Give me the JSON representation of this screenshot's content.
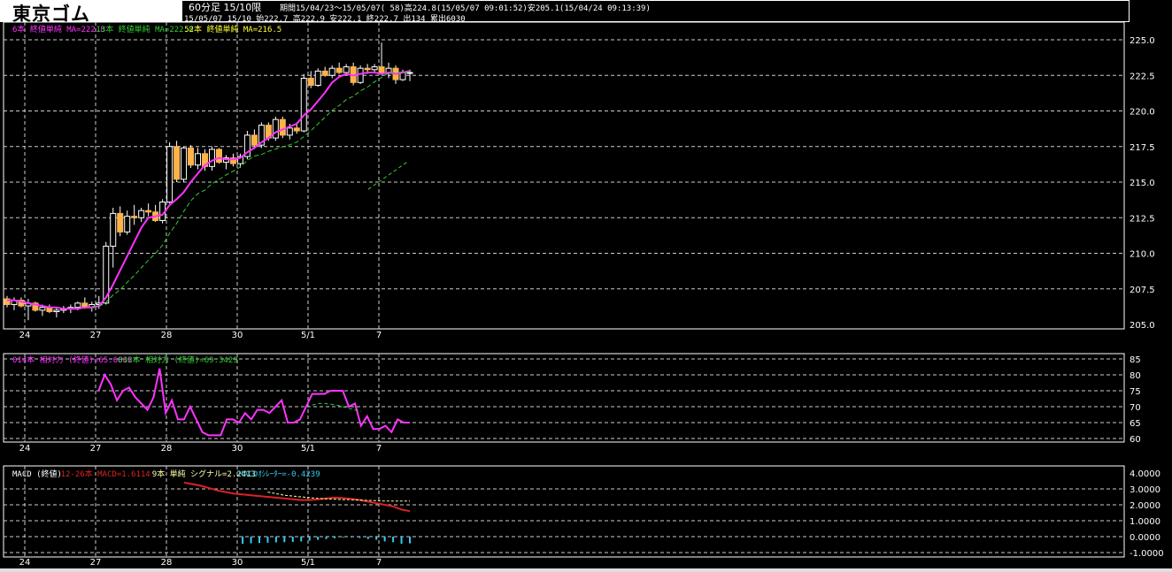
{
  "header": {
    "title": "東京ゴム",
    "timeframe": "60分足 15/10限",
    "period": "期間15/04/23〜15/05/07( 58)高224.8(15/05/07 09:01:52)安205.1(15/04/24 09:13:39)",
    "ohlc": "15/05/07 15/10 始222.7 高222.9 安222.1 終222.7 出134 累出6030"
  },
  "colors": {
    "ma6": "#ff33ff",
    "ma13": "#33cc33",
    "ma52": "#ffff33",
    "candle_up": "#ffb347",
    "macd": "#dd2222",
    "signal": "#ffffaa",
    "hist": "#33ccee"
  },
  "chart_data": [
    {
      "type": "candlestick",
      "legend": [
        {
          "text": "6本 終値単純 MA=222.8",
          "color": "#ff33ff"
        },
        {
          "text": "13本 終値単純 MA=222.8",
          "color": "#33cc33"
        },
        {
          "text": "52本 終値単純 MA=216.5",
          "color": "#ffff33"
        }
      ],
      "xticks": [
        "24",
        "27",
        "28",
        "30",
        "5/1",
        "7"
      ],
      "yticks": [
        "225.0",
        "222.5",
        "220.0",
        "217.5",
        "215.0",
        "212.5",
        "210.0",
        "207.5",
        "205.0"
      ],
      "ylim": [
        205.0,
        226.0
      ],
      "candles": [
        [
          206.8,
          207.0,
          206.2,
          206.4
        ],
        [
          206.4,
          206.9,
          206.0,
          206.7
        ],
        [
          206.7,
          206.9,
          206.2,
          206.3
        ],
        [
          206.3,
          206.8,
          205.3,
          206.5
        ],
        [
          206.5,
          206.6,
          205.9,
          206.0
        ],
        [
          206.0,
          206.4,
          205.6,
          206.2
        ],
        [
          206.2,
          206.4,
          205.8,
          205.9
        ],
        [
          205.9,
          206.2,
          205.5,
          206.0
        ],
        [
          206.0,
          206.3,
          205.8,
          206.1
        ],
        [
          206.1,
          206.4,
          205.8,
          206.2
        ],
        [
          206.2,
          206.6,
          206.0,
          206.5
        ],
        [
          206.5,
          206.9,
          206.1,
          206.2
        ],
        [
          206.2,
          206.6,
          205.9,
          206.4
        ],
        [
          206.4,
          207.0,
          206.1,
          206.5
        ],
        [
          206.5,
          210.8,
          206.4,
          210.5
        ],
        [
          210.5,
          213.2,
          209.0,
          212.8
        ],
        [
          212.8,
          213.3,
          211.2,
          211.5
        ],
        [
          211.5,
          213.0,
          211.3,
          212.6
        ],
        [
          212.6,
          213.4,
          212.0,
          212.5
        ],
        [
          212.5,
          213.2,
          212.2,
          213.0
        ],
        [
          213.0,
          213.5,
          212.6,
          212.9
        ],
        [
          212.9,
          213.4,
          212.2,
          212.3
        ],
        [
          212.3,
          213.8,
          212.1,
          213.6
        ],
        [
          213.6,
          217.8,
          213.5,
          217.5
        ],
        [
          217.5,
          217.9,
          215.0,
          215.2
        ],
        [
          215.2,
          217.5,
          215.0,
          217.4
        ],
        [
          217.4,
          217.6,
          216.0,
          216.2
        ],
        [
          216.2,
          217.4,
          215.9,
          217.0
        ],
        [
          217.0,
          217.3,
          215.8,
          216.1
        ],
        [
          216.1,
          217.5,
          215.8,
          217.3
        ],
        [
          217.3,
          217.4,
          216.3,
          216.4
        ],
        [
          216.4,
          216.9,
          215.9,
          216.7
        ],
        [
          216.7,
          217.0,
          216.1,
          216.3
        ],
        [
          216.3,
          217.0,
          216.0,
          216.8
        ],
        [
          216.8,
          218.6,
          216.6,
          218.3
        ],
        [
          218.3,
          218.7,
          217.4,
          217.6
        ],
        [
          217.6,
          219.2,
          217.4,
          219.0
        ],
        [
          219.0,
          219.2,
          217.9,
          218.1
        ],
        [
          218.1,
          219.6,
          217.9,
          219.4
        ],
        [
          219.4,
          219.6,
          218.1,
          218.3
        ],
        [
          218.3,
          219.1,
          218.0,
          218.8
        ],
        [
          218.8,
          219.2,
          218.4,
          218.6
        ],
        [
          218.6,
          222.6,
          218.5,
          222.3
        ],
        [
          222.3,
          222.8,
          221.6,
          221.8
        ],
        [
          221.8,
          223.0,
          221.7,
          222.8
        ],
        [
          222.8,
          223.1,
          222.4,
          222.5
        ],
        [
          222.5,
          223.2,
          222.3,
          223.0
        ],
        [
          223.0,
          223.4,
          222.6,
          222.7
        ],
        [
          222.7,
          223.3,
          222.5,
          223.1
        ],
        [
          223.1,
          223.4,
          221.8,
          222.0
        ],
        [
          222.0,
          223.2,
          221.9,
          223.0
        ],
        [
          223.0,
          223.3,
          222.6,
          222.9
        ],
        [
          222.9,
          223.3,
          222.7,
          223.1
        ],
        [
          223.1,
          224.8,
          222.8,
          222.7
        ],
        [
          222.7,
          223.4,
          222.3,
          223.0
        ],
        [
          223.0,
          223.2,
          221.9,
          222.2
        ],
        [
          222.2,
          222.9,
          222.1,
          222.7
        ],
        [
          222.7,
          222.9,
          222.1,
          222.7
        ]
      ],
      "ma6": [
        206.7,
        206.7,
        206.6,
        206.5,
        206.4,
        206.3,
        206.2,
        206.2,
        206.1,
        206.1,
        206.1,
        206.2,
        206.2,
        206.3,
        206.9,
        207.8,
        208.8,
        209.8,
        210.8,
        211.8,
        212.5,
        212.6,
        212.7,
        213.4,
        213.8,
        214.3,
        215.0,
        215.6,
        216.2,
        216.5,
        216.7,
        216.6,
        216.6,
        216.7,
        217.1,
        217.4,
        217.8,
        218.1,
        218.5,
        218.7,
        218.9,
        219.1,
        219.7,
        220.1,
        220.7,
        221.3,
        222.0,
        222.4,
        222.6,
        222.5,
        222.6,
        222.7,
        222.7,
        222.6,
        222.7,
        222.6,
        222.7,
        222.8
      ]
    },
    {
      "type": "line",
      "legend": [
        {
          "text": "014本 相対力 (終値)=65.6836",
          "color": "#ff33ff"
        },
        {
          "text": "042本 相対力 (終値)=69.3429",
          "color": "#33cc33"
        }
      ],
      "xticks": [
        "24",
        "27",
        "28",
        "30",
        "5/1",
        "7"
      ],
      "yticks": [
        "85",
        "80",
        "75",
        "70",
        "65",
        "60"
      ],
      "ylim": [
        60,
        85
      ],
      "rsi14": [
        null,
        null,
        null,
        null,
        null,
        null,
        null,
        null,
        null,
        null,
        null,
        null,
        null,
        null,
        null,
        75,
        80,
        77,
        72,
        75,
        76,
        73,
        71,
        69,
        73,
        82,
        68,
        72,
        66,
        66,
        70,
        66,
        62,
        61,
        61,
        61,
        66,
        66,
        65,
        68,
        66,
        69,
        69,
        68,
        70,
        72,
        65,
        65,
        66,
        70,
        74,
        74,
        74,
        75,
        75,
        75,
        70,
        71,
        64,
        67,
        63,
        63,
        64,
        62,
        66,
        65,
        65
      ],
      "rsi42": [
        null,
        null,
        null,
        null,
        null,
        null,
        null,
        null,
        null,
        null,
        null,
        null,
        null,
        null,
        null,
        null,
        null,
        null,
        null,
        null,
        null,
        null,
        null,
        null,
        null,
        null,
        null,
        null,
        null,
        null,
        null,
        null,
        null,
        null,
        null,
        null,
        null,
        null,
        null,
        null,
        null,
        null,
        null,
        null,
        null,
        null,
        null,
        null,
        null,
        null,
        70.5,
        71,
        71,
        70.8,
        70.5,
        70,
        69.5,
        69,
        68.5,
        null,
        null,
        null,
        null,
        null,
        null,
        null,
        null
      ]
    },
    {
      "type": "line",
      "legend": [
        {
          "text": "MACD (終値)",
          "color": "#ffffff"
        },
        {
          "text": "12-26本 MACD=1.6114",
          "color": "#dd2222"
        },
        {
          "text": "9本 単純 シグナル=2.2413",
          "color": "#ffffaa"
        },
        {
          "text": "MACDｵｼﾚｰﾀｰ=-0.4239",
          "color": "#33ccee"
        }
      ],
      "xticks": [
        "24",
        "27",
        "28",
        "30",
        "5/1",
        "7"
      ],
      "yticks": [
        "4.0000",
        "3.0000",
        "2.0000",
        "1.0000",
        "0.0000",
        "-1.0000"
      ],
      "ylim": [
        -1.0,
        4.0
      ],
      "macd": [
        3.4,
        3.3,
        3.2,
        3.05,
        2.9,
        2.8,
        2.7,
        2.65,
        2.6,
        2.55,
        2.5,
        2.45,
        2.4,
        2.35,
        2.3,
        2.3,
        2.35,
        2.4,
        2.45,
        2.42,
        2.38,
        2.3,
        2.2,
        2.1,
        2.0,
        1.9,
        1.7,
        1.6
      ],
      "signal": [
        null,
        null,
        null,
        null,
        null,
        null,
        null,
        null,
        null,
        null,
        2.8,
        2.7,
        2.6,
        2.55,
        2.5,
        2.45,
        2.4,
        2.38,
        2.35,
        2.33,
        2.32,
        2.3,
        2.28,
        2.26,
        2.24,
        2.24,
        2.24,
        2.24
      ],
      "hist": [
        null,
        null,
        null,
        null,
        null,
        null,
        null,
        -0.45,
        -0.42,
        -0.4,
        -0.38,
        -0.36,
        -0.35,
        -0.33,
        -0.3,
        -0.25,
        -0.2,
        -0.15,
        -0.1,
        -0.05,
        -0.05,
        -0.08,
        -0.15,
        -0.2,
        -0.3,
        -0.35,
        -0.45,
        -0.42
      ]
    }
  ]
}
